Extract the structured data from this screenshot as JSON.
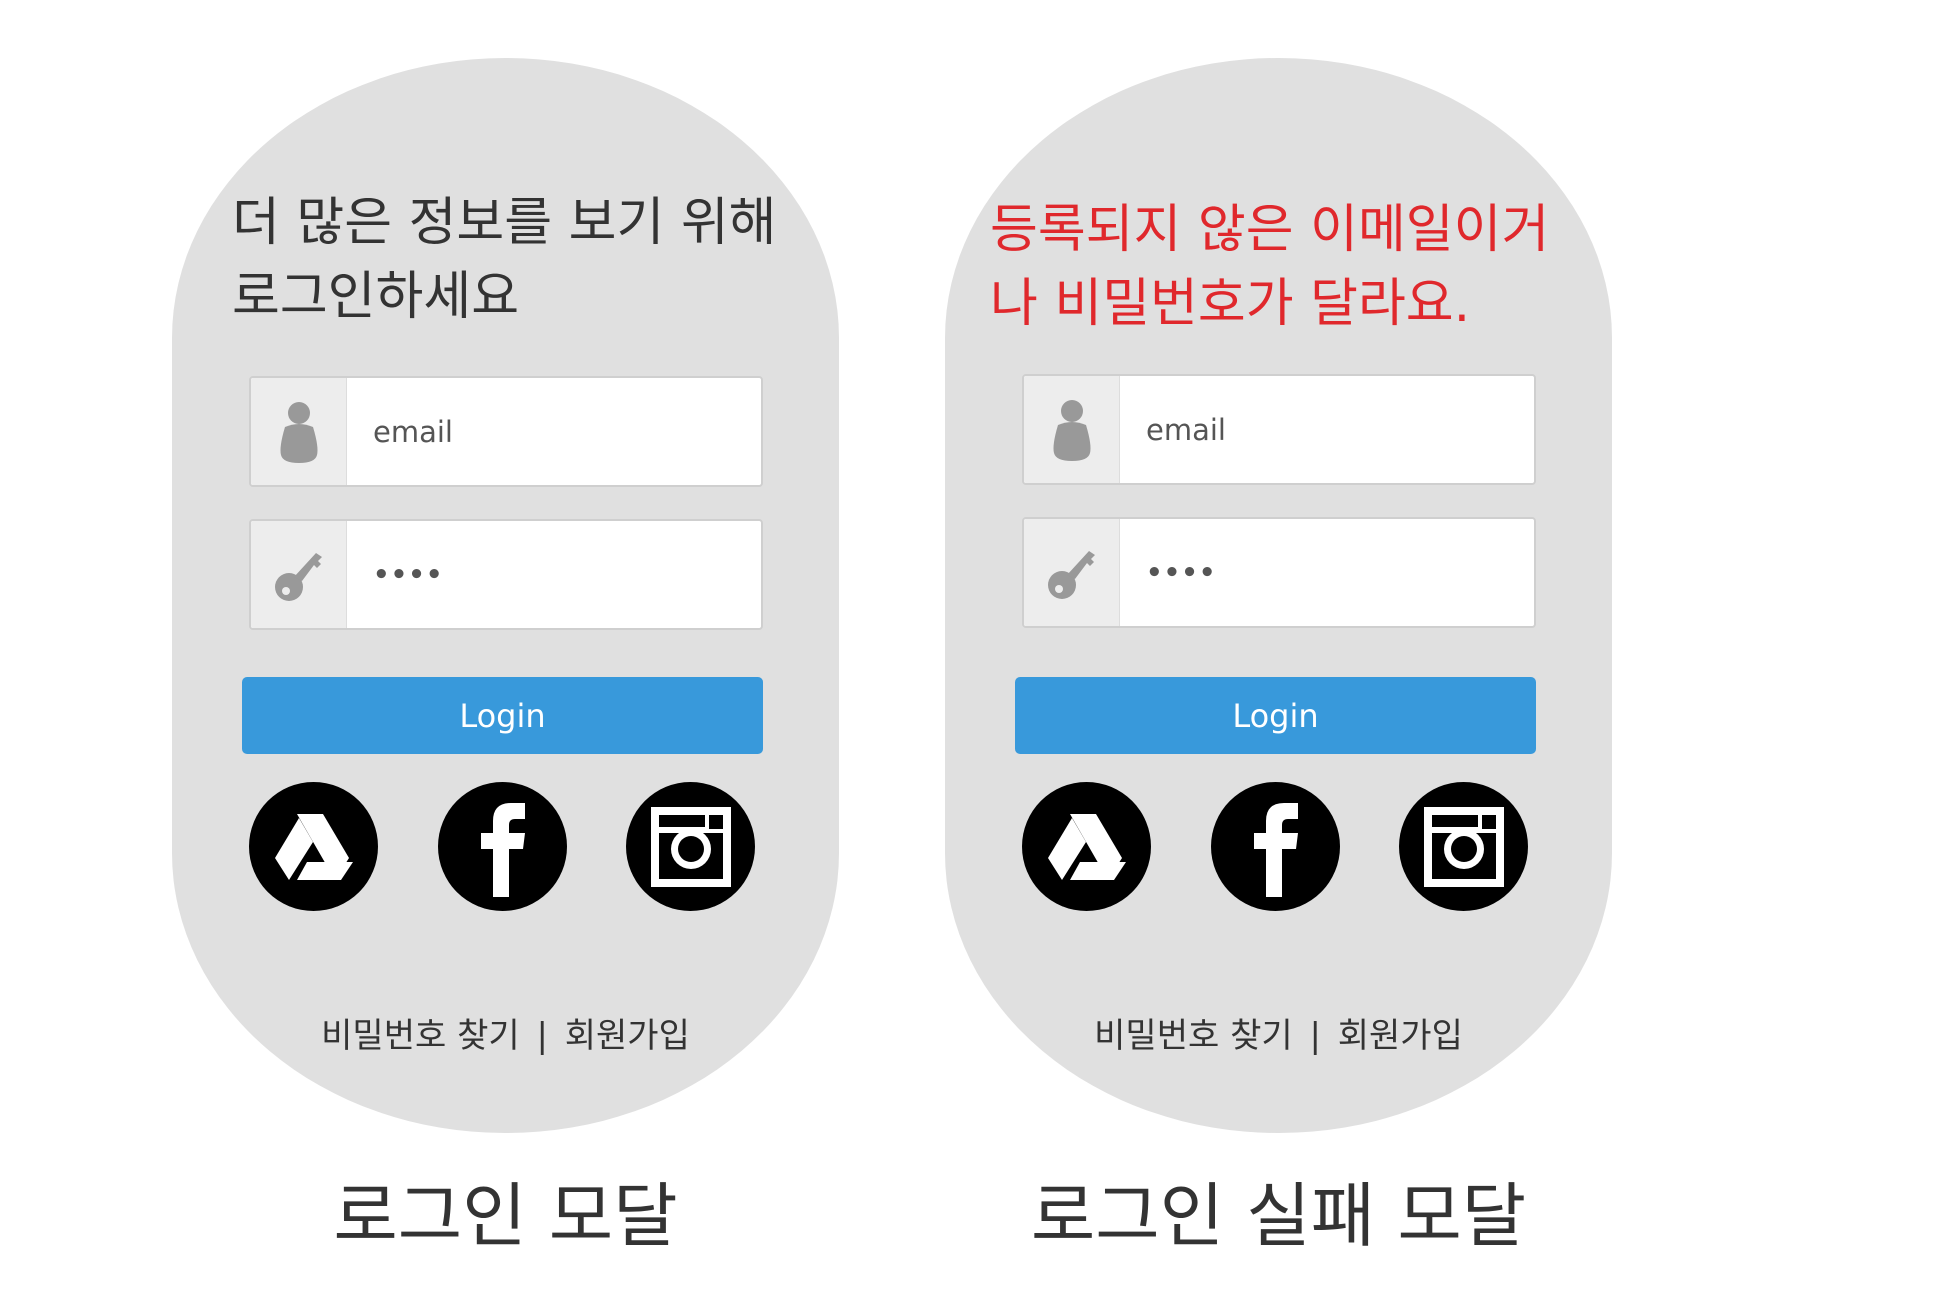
{
  "login_modal": {
    "headline_line1": "더 많은 정보를 보기 위해",
    "headline_line2": "로그인하세요",
    "email_value": "email",
    "password_value": "••••",
    "login_label": "Login",
    "find_password": "비밀번호 찾기",
    "separator": "|",
    "signup": "회원가입",
    "caption": "로그인 모달"
  },
  "login_fail_modal": {
    "error_line1": "등록되지 않은 이메일이거",
    "error_line2": "나 비밀번호가 달라요.",
    "email_value": "email",
    "password_value": "••••",
    "login_label": "Login",
    "find_password": "비밀번호 찾기",
    "separator": "|",
    "signup": "회원가입",
    "caption": "로그인 실패 모달"
  },
  "icons": {
    "user": "user-icon",
    "key": "key-icon",
    "drive": "google-drive-icon",
    "facebook": "facebook-icon",
    "instagram": "instagram-icon"
  },
  "colors": {
    "modal_bg": "#e0e0e0",
    "login_button": "#3899db",
    "error_text": "#e0282c",
    "text": "#333333"
  }
}
